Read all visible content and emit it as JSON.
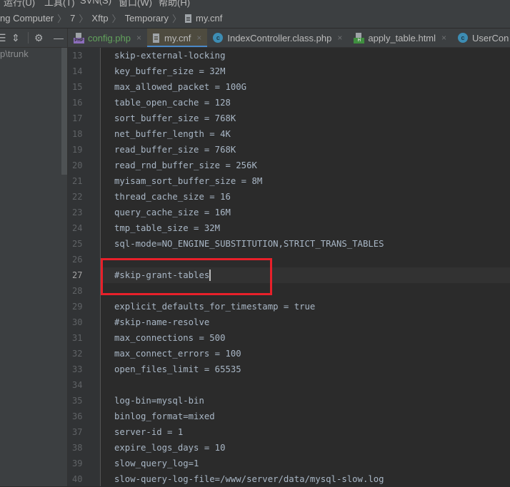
{
  "menubar": {
    "items": [
      "运行(U)",
      "工具(T)",
      "SVN(S)",
      "窗口(W)",
      "帮助(H)"
    ]
  },
  "breadcrumb": {
    "items": [
      "ng Computer",
      "7",
      "Xftp",
      "Temporary",
      "my.cnf"
    ]
  },
  "project_panel": {
    "toolbar_icons": [
      "collapse-all-icon",
      "expand-icon",
      "gear-icon",
      "minimize-icon"
    ],
    "path_text": "p\\trunk"
  },
  "tabs": [
    {
      "label": "config.php",
      "icon": "php-file-icon",
      "active": false,
      "modified": true
    },
    {
      "label": "my.cnf",
      "icon": "text-file-icon",
      "active": true
    },
    {
      "label": "IndexController.class.php",
      "icon": "class-icon",
      "active": false
    },
    {
      "label": "apply_table.html",
      "icon": "html-file-icon",
      "active": false
    },
    {
      "label": "UserCon",
      "icon": "class-icon",
      "active": false
    }
  ],
  "tab_close_glyph": "×",
  "editor": {
    "current_line": 27,
    "lines": [
      {
        "n": "13",
        "text": "skip-external-locking"
      },
      {
        "n": "14",
        "text": "key_buffer_size = 32M"
      },
      {
        "n": "15",
        "text": "max_allowed_packet = 100G"
      },
      {
        "n": "16",
        "text": "table_open_cache = 128"
      },
      {
        "n": "17",
        "text": "sort_buffer_size = 768K"
      },
      {
        "n": "18",
        "text": "net_buffer_length = 4K"
      },
      {
        "n": "19",
        "text": "read_buffer_size = 768K"
      },
      {
        "n": "20",
        "text": "read_rnd_buffer_size = 256K"
      },
      {
        "n": "21",
        "text": "myisam_sort_buffer_size = 8M"
      },
      {
        "n": "22",
        "text": "thread_cache_size = 16"
      },
      {
        "n": "23",
        "text": "query_cache_size = 16M"
      },
      {
        "n": "24",
        "text": "tmp_table_size = 32M"
      },
      {
        "n": "25",
        "text": "sql-mode=NO_ENGINE_SUBSTITUTION,STRICT_TRANS_TABLES"
      },
      {
        "n": "26",
        "text": ""
      },
      {
        "n": "27",
        "text": "#skip-grant-tables"
      },
      {
        "n": "28",
        "text": ""
      },
      {
        "n": "29",
        "text": "explicit_defaults_for_timestamp = true"
      },
      {
        "n": "30",
        "text": "#skip-name-resolve"
      },
      {
        "n": "31",
        "text": "max_connections = 500"
      },
      {
        "n": "32",
        "text": "max_connect_errors = 100"
      },
      {
        "n": "33",
        "text": "open_files_limit = 65535"
      },
      {
        "n": "34",
        "text": ""
      },
      {
        "n": "35",
        "text": "log-bin=mysql-bin"
      },
      {
        "n": "36",
        "text": "binlog_format=mixed"
      },
      {
        "n": "37",
        "text": "server-id = 1"
      },
      {
        "n": "38",
        "text": "expire_logs_days = 10"
      },
      {
        "n": "39",
        "text": "slow_query_log=1"
      },
      {
        "n": "40",
        "text": "slow-query-log-file=/www/server/data/mysql-slow.log"
      }
    ]
  },
  "annotation": {
    "color": "#e8202a",
    "target_line": 27
  }
}
